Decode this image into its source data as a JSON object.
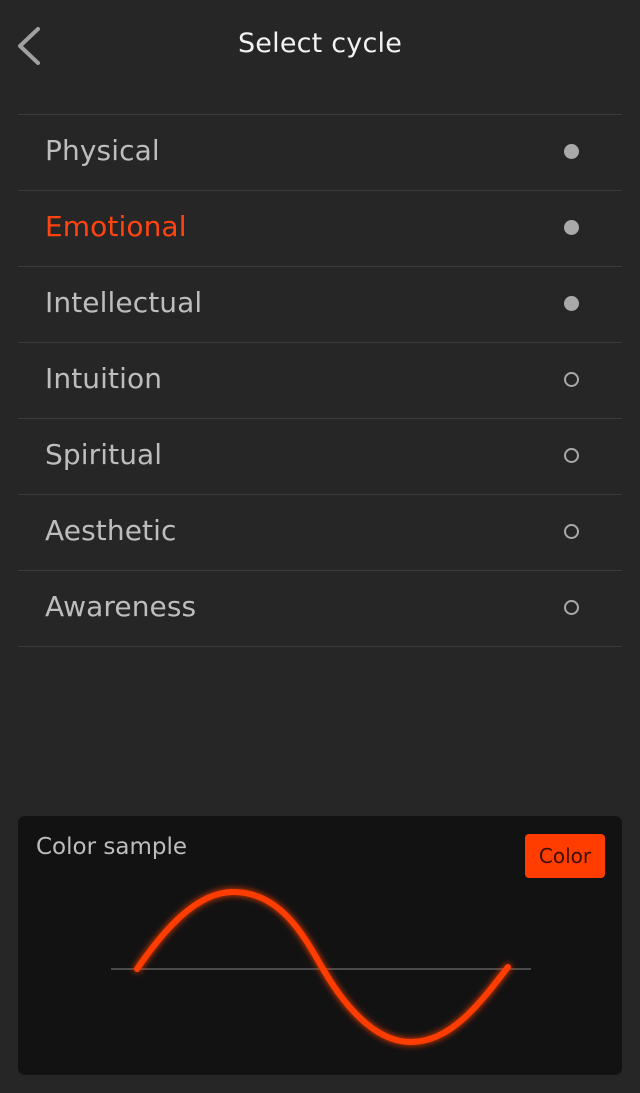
{
  "header": {
    "title": "Select cycle",
    "back_icon": "chevron-left-icon"
  },
  "cycles": [
    {
      "label": "Physical",
      "selected": true
    },
    {
      "label": "Emotional",
      "selected": true,
      "active": true
    },
    {
      "label": "Intellectual",
      "selected": true
    },
    {
      "label": "Intuition",
      "selected": false
    },
    {
      "label": "Spiritual",
      "selected": false
    },
    {
      "label": "Aesthetic",
      "selected": false
    },
    {
      "label": "Awareness",
      "selected": false
    }
  ],
  "sample": {
    "label": "Color sample",
    "button_label": "Color"
  },
  "colors": {
    "background": "#262626",
    "panel": "#121212",
    "accent": "#ff3d00",
    "active_text": "#ff4411",
    "text": "#bdbdbd"
  }
}
